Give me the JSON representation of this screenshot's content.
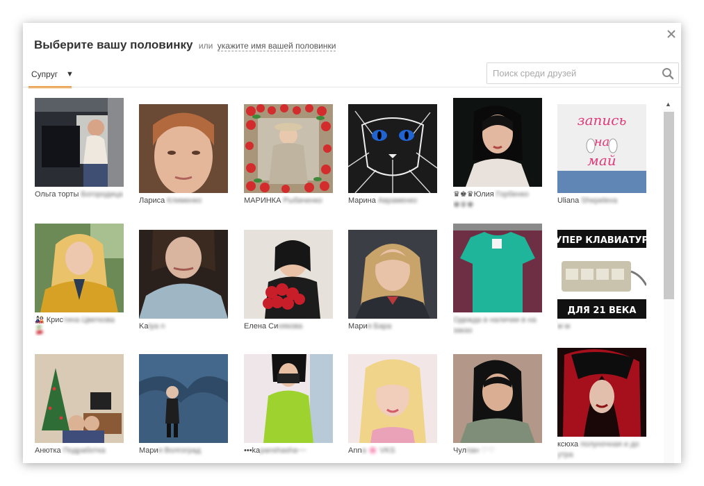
{
  "dialog": {
    "title": "Выберите вашу половинку",
    "or_text": "или",
    "link_text": "укажите имя вашей половинки"
  },
  "tab": {
    "label": "Супруг"
  },
  "search": {
    "placeholder": "Поиск среди друзей"
  },
  "friends": [
    {
      "name_a": "Ольга торты",
      "name_b": " Богородица"
    },
    {
      "name_a": "Лариса ",
      "name_b": "Клименко"
    },
    {
      "name_a": "МАРИНКА ",
      "name_b": "Рыбаченко"
    },
    {
      "name_a": "Марина ",
      "name_b": "Авраменко"
    },
    {
      "name_a": "♛♚♛Юлия",
      "name_b": " Горбенко ♚♛♚"
    },
    {
      "name_a": "Uliana ",
      "name_b": "Shepeleva"
    },
    {
      "name_a": "🎎 Крис",
      "name_b": "тина Цветкова 🍒"
    },
    {
      "name_a": "Ka",
      "name_b": "tya n"
    },
    {
      "name_a": "Елена Си",
      "name_b": "някова"
    },
    {
      "name_a": "Мари",
      "name_b": "я Бара"
    },
    {
      "name_a": "",
      "name_b": "Одежда в наличии в на заказ"
    },
    {
      "name_a": "",
      "name_b": "м м"
    },
    {
      "name_a": "Анютка ",
      "name_b": "Подработка"
    },
    {
      "name_a": "Мари",
      "name_b": "я Волгоград"
    },
    {
      "name_a": "•••ka",
      "name_b": "panshasha~~"
    },
    {
      "name_a": "Ann",
      "name_b": "a 🌸 VKS"
    },
    {
      "name_a": "Чул",
      "name_b": "пан ♡♡"
    },
    {
      "name_a": "ксюха ",
      "name_b": "полуночная и до утра"
    }
  ],
  "colors": {
    "accent": "#ee8208"
  },
  "icons": {
    "close": "close-icon",
    "search": "search-icon",
    "caret": "caret-down-icon",
    "scroll_up": "scroll-up-icon"
  }
}
